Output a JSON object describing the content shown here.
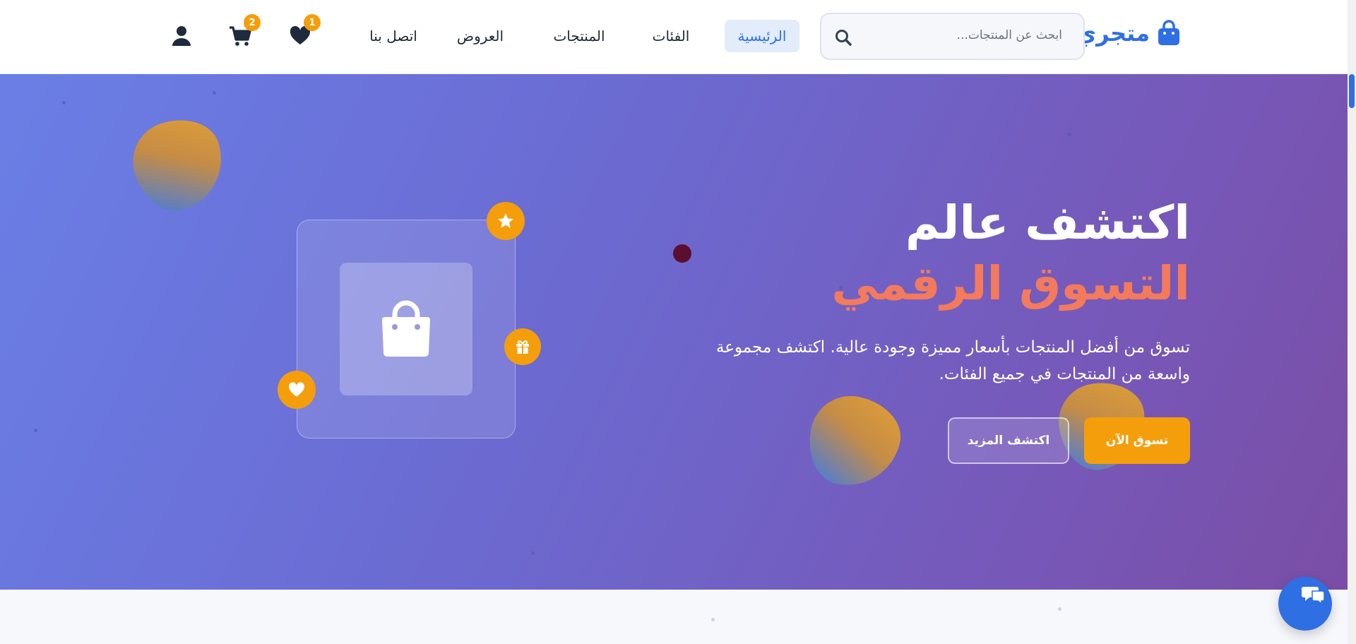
{
  "header": {
    "logo_text": "متجري",
    "search_placeholder": "ابحث عن المنتجات...",
    "nav": {
      "home": "الرئيسية",
      "categories": "الفئات",
      "products": "المنتجات",
      "offers": "العروض",
      "contact": "اتصل بنا"
    },
    "wishlist_count": "1",
    "cart_count": "2"
  },
  "hero": {
    "title_line1": "اكتشف عالم",
    "title_line2": "التسوق الرقمي",
    "subtitle": "تسوق من أفضل المنتجات بأسعار مميزة وجودة عالية. اكتشف مجموعة واسعة من المنتجات في جميع الفئات.",
    "primary_button": "تسوق الآن",
    "secondary_button": "اكتشف المزيد"
  },
  "colors": {
    "brand": "#2f6fe4",
    "accent": "#f59e0b",
    "hero_start": "#6a7fe6",
    "hero_end": "#7a4ea5",
    "headline_accent": "#f47a5c"
  },
  "icons": {
    "logo": "shopping-bag-icon",
    "search": "search-icon",
    "wishlist": "heart-icon",
    "cart": "cart-icon",
    "user": "user-icon",
    "hero_center": "shopping-bag-icon",
    "float_1": "star-icon",
    "float_2": "gift-icon",
    "float_3": "heart-icon",
    "chat": "chat-icon"
  }
}
